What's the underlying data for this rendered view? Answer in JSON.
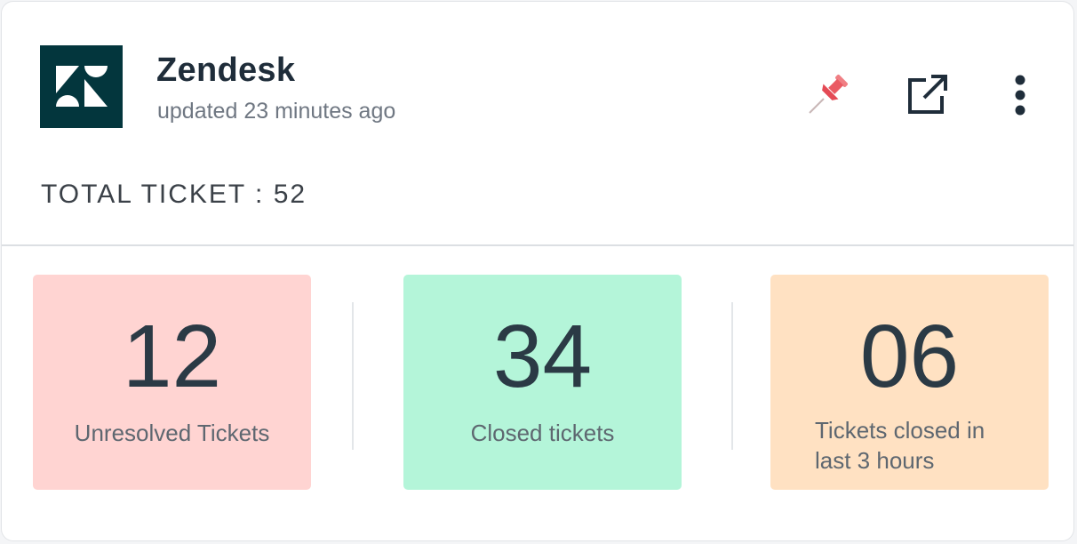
{
  "widget": {
    "app_name": "Zendesk",
    "updated": "updated 23 minutes ago",
    "logo_icon": "zendesk-logo",
    "logo_bg": "#03363d",
    "actions": [
      {
        "name": "pin-icon",
        "color": "#e8616b"
      },
      {
        "name": "open-external-icon",
        "color": "#1f2d3a"
      },
      {
        "name": "more-vertical-icon",
        "color": "#1f2d3a"
      }
    ],
    "total_label": "TOTAL TICKET : 52"
  },
  "stats": [
    {
      "value": "12",
      "label": "Unresolved Tickets",
      "bg": "#ffd4d2"
    },
    {
      "value": "34",
      "label": "Closed tickets",
      "bg": "#b4f5d9"
    },
    {
      "value": "06",
      "label": "Tickets closed in last 3 hours",
      "bg": "#ffe1c2"
    }
  ]
}
